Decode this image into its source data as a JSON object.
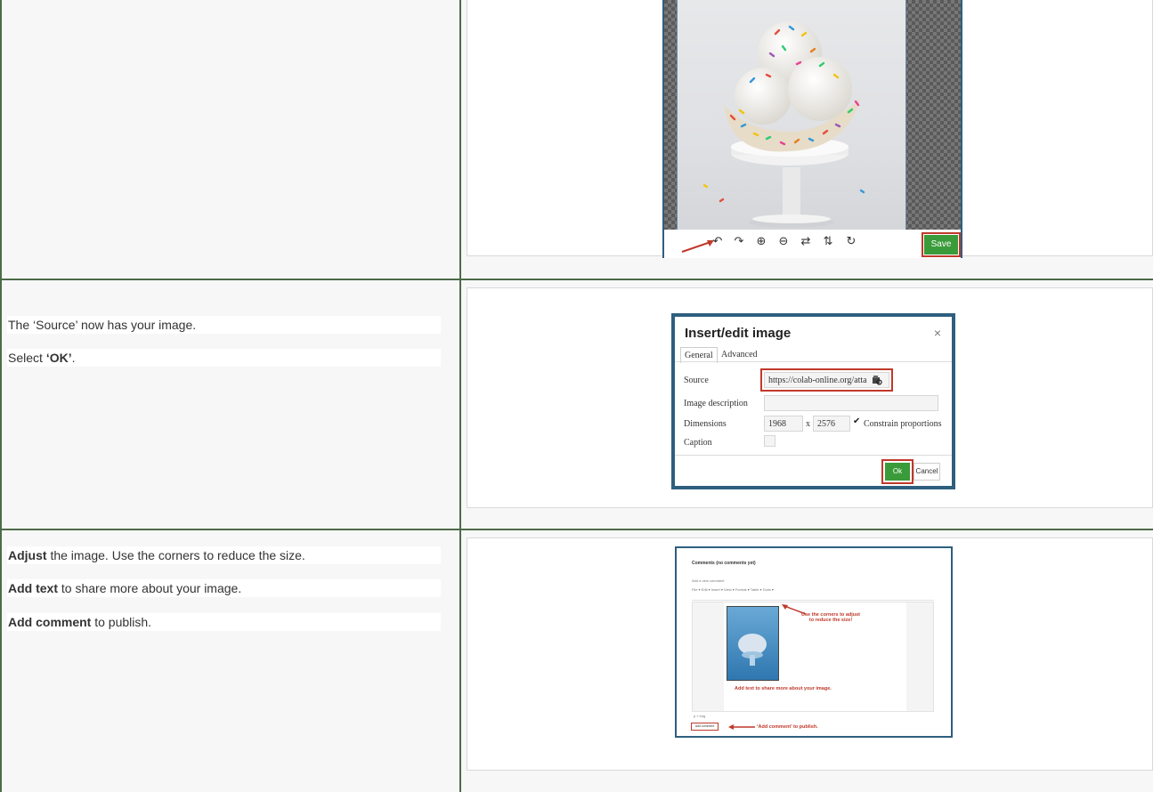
{
  "rows": [
    {
      "paragraphs": []
    },
    {
      "paragraphs": [
        {
          "text": "The ‘Source’ now has your image."
        },
        {
          "pre": "Select ",
          "bold": "‘OK’",
          "post": "."
        }
      ]
    },
    {
      "paragraphs": [
        {
          "bold": "Adjust",
          "post": " the image. Use the corners to reduce the size."
        },
        {
          "bold": "Add text",
          "post": " to share more about your image."
        },
        {
          "bold": "Add comment",
          "post": " to publish."
        }
      ]
    }
  ],
  "editor": {
    "toolbar_icons": [
      "rotate-left-icon",
      "rotate-right-icon",
      "zoom-in-icon",
      "zoom-out-icon",
      "flip-horizontal-icon",
      "flip-vertical-icon",
      "reset-icon"
    ],
    "save_label": "Save"
  },
  "dialog": {
    "title": "Insert/edit image",
    "close": "×",
    "tabs": [
      "General",
      "Advanced"
    ],
    "source_label": "Source",
    "source_value": "https://colab-online.org/atta",
    "description_label": "Image description",
    "description_value": "",
    "dimensions_label": "Dimensions",
    "width": "1968",
    "times": "x",
    "height": "2576",
    "constrain_label": "Constrain proportions",
    "caption_label": "Caption",
    "ok_label": "Ok",
    "cancel_label": "Cancel"
  },
  "comment_shot": {
    "heading": "Comments (no comments yet)",
    "add_new": "Add a new comment",
    "menus": "File ▾   Edit ▾   Insert ▾   View ▾   Format ▾   Table ▾   Tools ▾",
    "note_corners": "Use the corners to adjust\nto reduce the size!",
    "note_text": "Add text to share more about your image.",
    "note_publish": "‘Add comment’ to publish.",
    "add_comment_button": "Add comment",
    "status": "p » img"
  },
  "colors": {
    "grid_line": "#4d6b48",
    "accent_red": "#c0392b",
    "button_green": "#3a9b3a",
    "frame_blue": "#2e5f7e"
  }
}
